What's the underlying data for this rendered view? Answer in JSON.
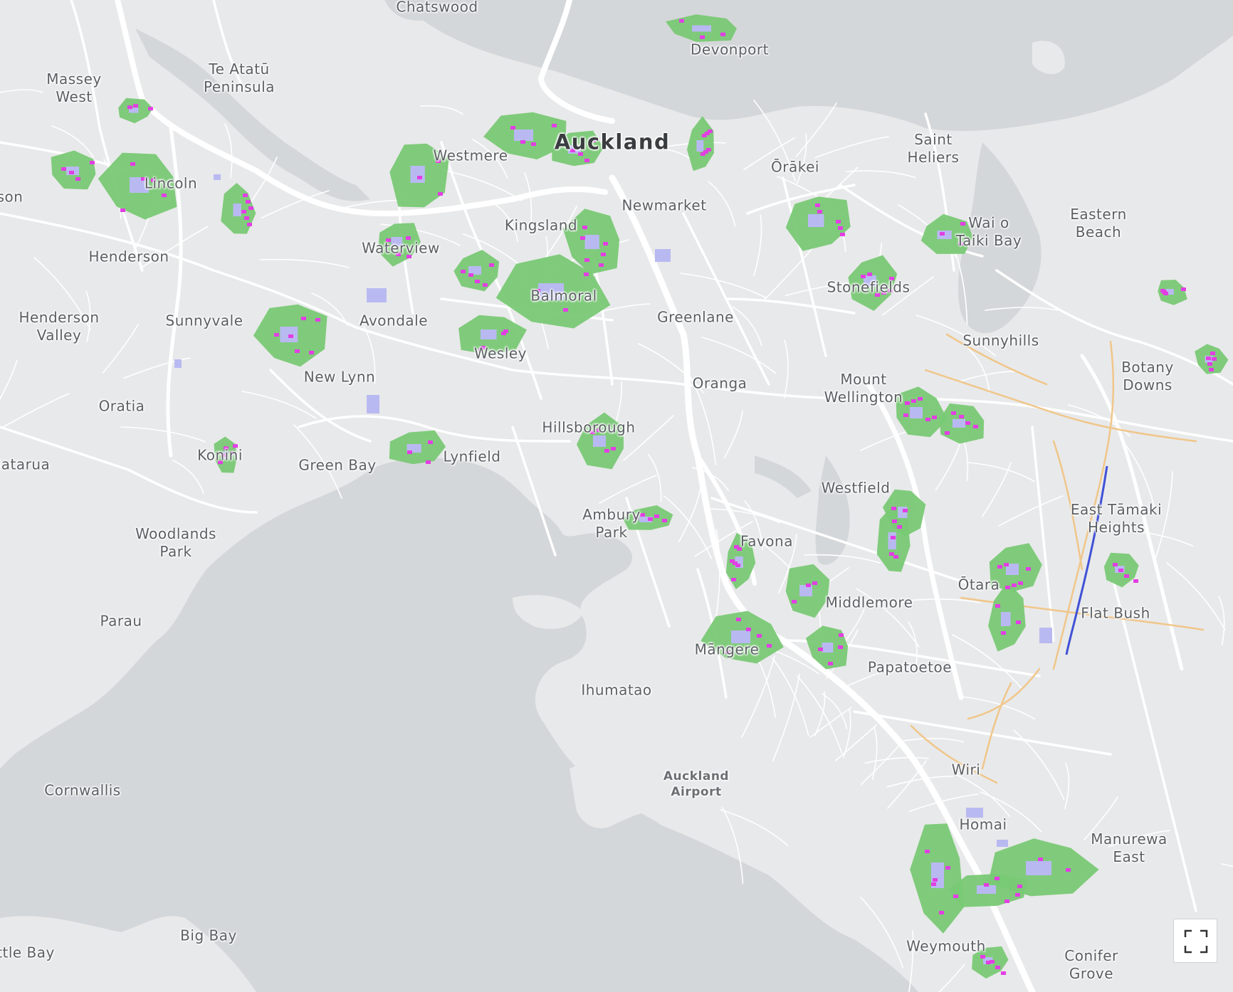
{
  "map": {
    "colors": {
      "water": "#d4d7d9",
      "land": "#e8e9ea",
      "road": "#ffffff",
      "green_area": "#79c975",
      "lavender_area": "#b9b9f2",
      "magenta_point": "#e23ee3",
      "orange_road": "#f0c68a",
      "blue_route": "#4051d6"
    },
    "city_label": "Auckland",
    "airport_label": "Auckland\nAirport",
    "place_labels": [
      "Chatswood",
      "Devonport",
      "Massey\nWest",
      "Te Atatū\nPeninsula",
      "Westmere",
      "Saint\nHeliers",
      "Ōrākei",
      "Lincoln",
      "son",
      "Newmarket",
      "Kingsland",
      "Wai o\nTaiki Bay",
      "Eastern\nBeach",
      "Henderson",
      "Waterview",
      "Stonefields",
      "Balmoral",
      "Henderson\nValley",
      "Sunnyvale",
      "Avondale",
      "Greenlane",
      "Sunnyhills",
      "Wesley",
      "Botany\nDowns",
      "New Lynn",
      "Oranga",
      "Mount\nWellington",
      "Oratia",
      "Hillsborough",
      "Konini",
      "Lynfield",
      "iatarua",
      "Green Bay",
      "Westfield",
      "East Tāmaki\nHeights",
      "Ambury\nPark",
      "Woodlands\nPark",
      "Favona",
      "Ōtara",
      "Middlemore",
      "Flat Bush",
      "Parau",
      "Māngere",
      "Papatoetoe",
      "Ihumatao",
      "Wiri",
      "Cornwallis",
      "Homai",
      "Manurewa\nEast",
      "Big Bay",
      "ttle Bay",
      "Weymouth",
      "Conifer\nGrove"
    ],
    "controls": {
      "fullscreen_icon": "fullscreen-expand-icon"
    }
  }
}
